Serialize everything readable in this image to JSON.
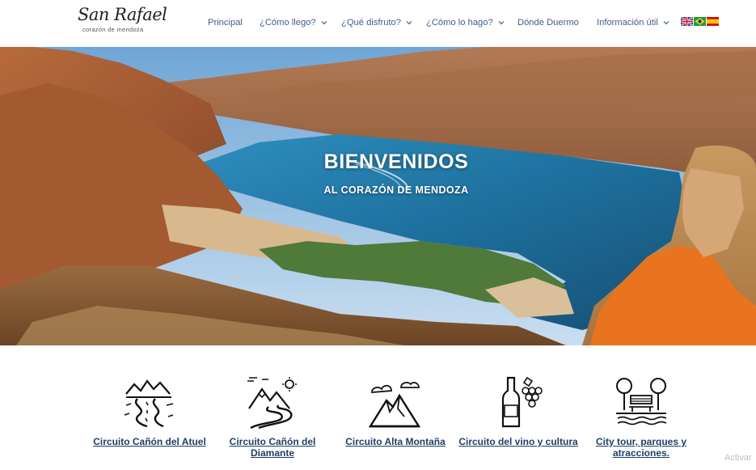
{
  "logo": {
    "title": "San Rafael",
    "tagline": "corazón de mendoza"
  },
  "nav": [
    {
      "label": "Principal",
      "dropdown": false
    },
    {
      "label": "¿Cómo llego?",
      "dropdown": true
    },
    {
      "label": "¿Qué disfruto?",
      "dropdown": true
    },
    {
      "label": "¿Cómo lo hago?",
      "dropdown": true
    },
    {
      "label": "Dónde Duermo",
      "dropdown": false
    },
    {
      "label": "Información útil",
      "dropdown": true
    }
  ],
  "languages": [
    "English",
    "Português",
    "Español"
  ],
  "hero": {
    "title": "BIENVENIDOS",
    "subtitle": "AL CORAZÓN DE MENDOZA"
  },
  "circuits": [
    {
      "label": "Circuito Cañón del Atuel",
      "icon": "canyon-road-icon"
    },
    {
      "label": "Circuito Cañón del Diamante",
      "icon": "mountain-road-icon"
    },
    {
      "label": "Circuito Alta Montaña",
      "icon": "mountain-peak-icon"
    },
    {
      "label": "Circuito del vino y cultura",
      "icon": "wine-grapes-icon"
    },
    {
      "label": "City tour, parques y atracciones.",
      "icon": "park-bench-icon"
    }
  ],
  "watermark": {
    "text": "Activar"
  },
  "colors": {
    "nav_link": "#3c5e8a",
    "circuit_link": "#1f3f66",
    "accent_sky": "#8dbde0",
    "lake": "#1d6f9c"
  }
}
